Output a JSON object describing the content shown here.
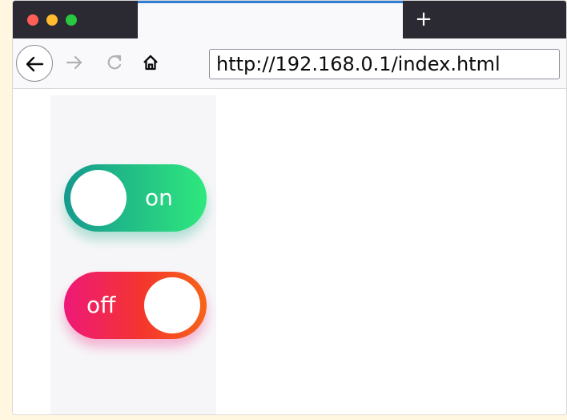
{
  "window": {
    "traffic_lights": [
      {
        "name": "close",
        "color": "#ff5f57"
      },
      {
        "name": "minimize",
        "color": "#febc2e"
      },
      {
        "name": "zoom",
        "color": "#28c840"
      }
    ],
    "active_tab_accent": "#2f7fd5",
    "new_tab_symbol": "+"
  },
  "navigation": {
    "back_icon": "arrow-left-icon",
    "forward_icon": "arrow-right-icon",
    "reload_icon": "reload-icon",
    "home_icon": "home-icon",
    "address": "http://192.168.0.1/index.html"
  },
  "toggles": [
    {
      "label": "on",
      "state": "on",
      "gradient": [
        "#16998f",
        "#2fe87d"
      ]
    },
    {
      "label": "off",
      "state": "off",
      "gradient": [
        "#ee1879",
        "#f76419"
      ]
    }
  ]
}
